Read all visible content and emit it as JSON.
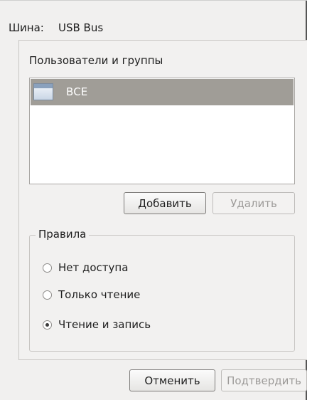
{
  "bus": {
    "label": "Шина:",
    "value": "USB Bus"
  },
  "users_section": {
    "title": "Пользователи и группы",
    "items": [
      {
        "label": "ВСЕ",
        "icon": "window-icon",
        "selected": true
      }
    ]
  },
  "list_actions": {
    "add_label": "Добавить",
    "remove_label": "Удалить"
  },
  "rules": {
    "title": "Правила",
    "options": [
      {
        "label": "Нет доступа",
        "checked": false
      },
      {
        "label": "Только чтение",
        "checked": false
      },
      {
        "label": "Чтение и запись",
        "checked": true
      }
    ]
  },
  "footer": {
    "cancel_label": "Отменить",
    "confirm_label": "Подтвердить"
  },
  "colors": {
    "selection": "#a09d97",
    "panel_bg": "#f2f1f0",
    "disabled_text": "#9c9a98"
  }
}
